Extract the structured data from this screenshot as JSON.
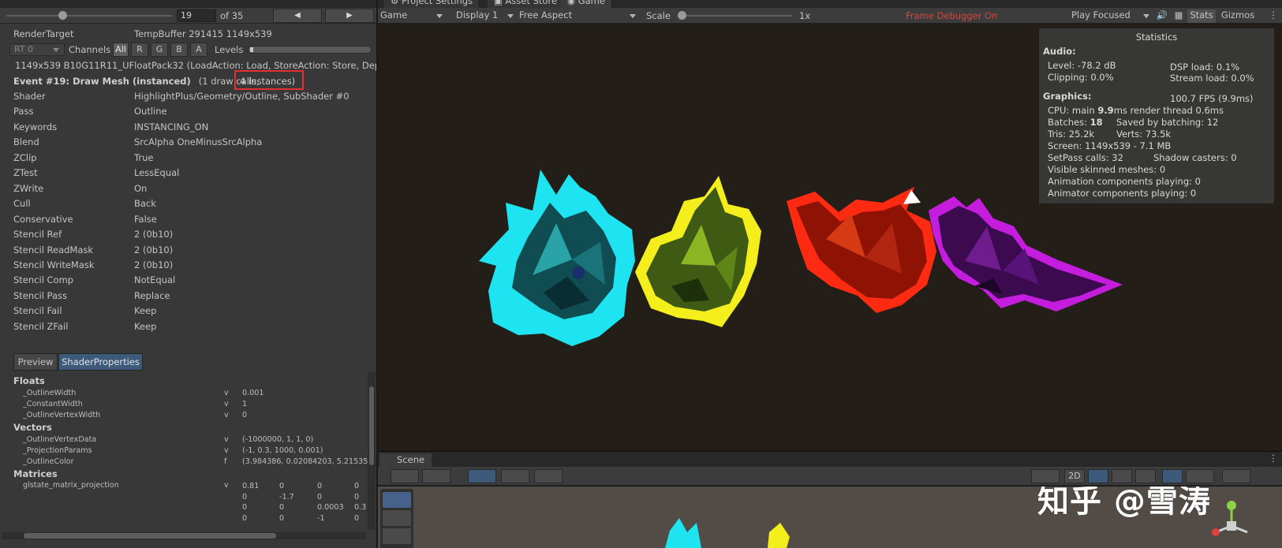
{
  "frame_debugger": {
    "current_event": "19",
    "event_total": "of 35",
    "render_target_label": "RenderTarget",
    "render_target_value": "TempBuffer 291415 1149x539",
    "rt_dropdown": "RT 0",
    "channels_label": "Channels",
    "channels": [
      "All",
      "R",
      "G",
      "B",
      "A"
    ],
    "levels_label": "Levels",
    "target_desc": "1149x539 B10G11R11_UFloatPack32 (LoadAction: Load, StoreAction: Store, Dept",
    "event_title": "Event #19: Draw Mesh (instanced)",
    "draw_calls": "(1 draw calls,",
    "instances": "4 instances)",
    "properties": [
      {
        "key": "Shader",
        "value": "HighlightPlus/Geometry/Outline, SubShader #0"
      },
      {
        "key": "Pass",
        "value": "Outline"
      },
      {
        "key": "Keywords",
        "value": "INSTANCING_ON"
      },
      {
        "key": "Blend",
        "value": "SrcAlpha OneMinusSrcAlpha"
      },
      {
        "key": "ZClip",
        "value": "True"
      },
      {
        "key": "ZTest",
        "value": "LessEqual"
      },
      {
        "key": "ZWrite",
        "value": "On"
      },
      {
        "key": "Cull",
        "value": "Back"
      },
      {
        "key": "Conservative",
        "value": "False"
      },
      {
        "key": "Stencil Ref",
        "value": "2 (0b10)"
      },
      {
        "key": "Stencil ReadMask",
        "value": "2 (0b10)"
      },
      {
        "key": "Stencil WriteMask",
        "value": "2 (0b10)"
      },
      {
        "key": "Stencil Comp",
        "value": "NotEqual"
      },
      {
        "key": "Stencil Pass",
        "value": "Replace"
      },
      {
        "key": "Stencil Fail",
        "value": "Keep"
      },
      {
        "key": "Stencil ZFail",
        "value": "Keep"
      }
    ],
    "tabs": {
      "preview": "Preview",
      "shader_props": "ShaderProperties"
    },
    "floats_header": "Floats",
    "floats": [
      {
        "name": "_OutlineWidth",
        "type": "v",
        "value": "0.001"
      },
      {
        "name": "_ConstantWidth",
        "type": "v",
        "value": "1"
      },
      {
        "name": "_OutlineVertexWidth",
        "type": "v",
        "value": "0"
      }
    ],
    "vectors_header": "Vectors",
    "vectors": [
      {
        "name": "_OutlineVertexData",
        "type": "v",
        "value": "(-1000000, 1, 1, 0)"
      },
      {
        "name": "_ProjectionParams",
        "type": "v",
        "value": "(-1, 0.3, 1000, 0.001)"
      },
      {
        "name": "_OutlineColor",
        "type": "f",
        "value": "(3.984386, 0.02084203, 5.21535"
      }
    ],
    "matrices_header": "Matrices",
    "matrix_name": "glstate_matrix_projection",
    "matrix_type": "v",
    "matrix_rows": [
      [
        "0.81",
        "0",
        "0",
        "0"
      ],
      [
        "0",
        "-1.7",
        "0",
        "0"
      ],
      [
        "0",
        "0",
        "0.0003",
        "0.3"
      ],
      [
        "0",
        "0",
        "-1",
        "0"
      ]
    ]
  },
  "tabs": [
    "Project Settings",
    "Asset Store",
    "Game"
  ],
  "game_toolbar": {
    "view": "Game",
    "display": "Display 1",
    "aspect": "Free Aspect",
    "scale_label": "Scale",
    "scale_value": "1x",
    "frame_debugger": "Frame Debugger On",
    "play_mode": "Play Focused",
    "stats": "Stats",
    "gizmos": "Gizmos"
  },
  "statistics": {
    "title": "Statistics",
    "audio_label": "Audio:",
    "level": "Level: -78.2 dB",
    "clipping": "Clipping: 0.0%",
    "dsp": "DSP load: 0.1%",
    "stream": "Stream load: 0.0%",
    "graphics_label": "Graphics:",
    "fps": "100.7 FPS (9.9ms)",
    "cpu_prefix": "CPU: main ",
    "cpu_main": "9.9",
    "cpu_suffix": "ms  render thread 0.6ms",
    "batches_prefix": "Batches: ",
    "batches": "18",
    "saved_batching": "Saved by batching: 12",
    "tris": "Tris: 25.2k",
    "verts": "Verts: 73.5k",
    "screen": "Screen: 1149x539 - 7.1 MB",
    "setpass": "SetPass calls: 32",
    "shadow_casters": "Shadow casters: 0",
    "skinned": "Visible skinned meshes: 0",
    "anim_components": "Animation components playing: 0",
    "animator_components": "Animator components playing: 0"
  },
  "scene": {
    "tab": "Scene",
    "mode_2d": "2D",
    "watermark": "知乎 @雪涛"
  },
  "colors": {
    "outline_cyan": "#1de4f0",
    "outline_yellow": "#f4ee1c",
    "outline_red": "#ff2a12",
    "outline_purple": "#c51dde",
    "frame_debugger_on": "#d8473f",
    "highlight_box": "#e03131"
  }
}
